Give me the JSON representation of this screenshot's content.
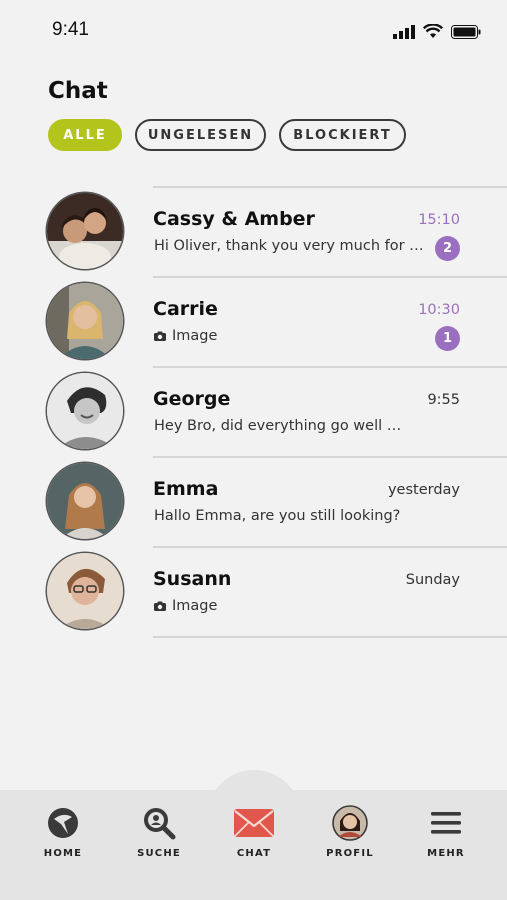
{
  "status": {
    "time": "9:41"
  },
  "header": {
    "title": "Chat"
  },
  "filters": {
    "all": "ALLE",
    "unread": "UNGELESEN",
    "blocked": "BLOCKIERT"
  },
  "chats": [
    {
      "name": "Cassy & Amber",
      "preview": "Hi Oliver, thank you very much for …",
      "time": "15:10",
      "unread": "2"
    },
    {
      "name": "Carrie",
      "preview": "Image",
      "time": "10:30",
      "unread": "1"
    },
    {
      "name": "George",
      "preview": "Hey Bro, did everything go well …",
      "time": "9:55"
    },
    {
      "name": "Emma",
      "preview": "Hallo Emma, are you still looking?",
      "time": "yesterday"
    },
    {
      "name": "Susann",
      "preview": "Image",
      "time": "Sunday"
    }
  ],
  "nav": {
    "home": "HOME",
    "search": "SUCHE",
    "chat": "CHAT",
    "profile": "PROFIL",
    "more": "MEHR"
  },
  "colors": {
    "accent": "#b3c41c",
    "unread": "#9b6fc0",
    "chat_icon": "#e2574c"
  }
}
